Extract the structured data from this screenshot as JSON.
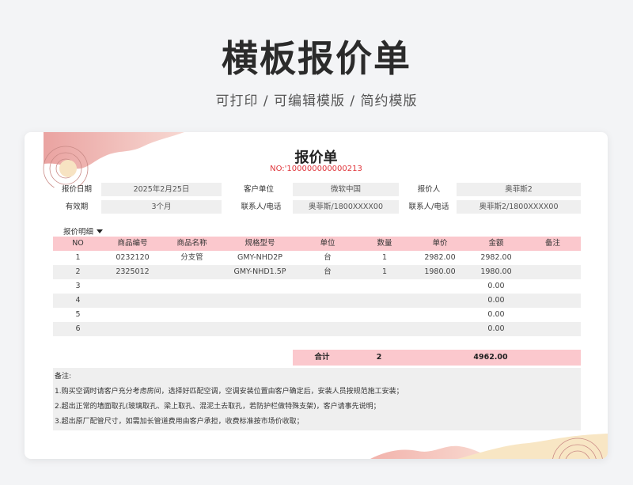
{
  "hero": {
    "title": "横板报价单",
    "subtitle": "可打印 / 可编辑模版 / 简约模版"
  },
  "doc": {
    "title": "报价单",
    "number": "NO:'100000000000213"
  },
  "info": {
    "row1": [
      {
        "label": "报价日期",
        "value": "2025年2月25日"
      },
      {
        "label": "客户单位",
        "value": "微软中国"
      },
      {
        "label": "报价人",
        "value": "奥菲斯2"
      }
    ],
    "row2": [
      {
        "label": "有效期",
        "value": "3个月"
      },
      {
        "label": "联系人/电话",
        "value": "奥菲斯/1800XXXX00"
      },
      {
        "label": "联系人/电话",
        "value": "奥菲斯2/1800XXXX00"
      }
    ]
  },
  "detail_label": "报价明细",
  "table": {
    "headers": [
      "NO",
      "商品编号",
      "商品名称",
      "规格型号",
      "单位",
      "数量",
      "单价",
      "金额",
      "备注"
    ],
    "rows": [
      [
        "1",
        "0232120",
        "分支管",
        "GMY-NHD2P",
        "台",
        "1",
        "2982.00",
        "2982.00",
        ""
      ],
      [
        "2",
        "2325012",
        "",
        "GMY-NHD1.5P",
        "台",
        "1",
        "1980.00",
        "1980.00",
        ""
      ],
      [
        "3",
        "",
        "",
        "",
        "",
        "",
        "",
        "0.00",
        ""
      ],
      [
        "4",
        "",
        "",
        "",
        "",
        "",
        "",
        "0.00",
        ""
      ],
      [
        "5",
        "",
        "",
        "",
        "",
        "",
        "",
        "0.00",
        ""
      ],
      [
        "6",
        "",
        "",
        "",
        "",
        "",
        "",
        "0.00",
        ""
      ]
    ]
  },
  "total": {
    "label": "合计",
    "qty": "2",
    "amount": "4962.00"
  },
  "notes": {
    "title": "备注:",
    "lines": [
      "1.购买空调时请客户充分考虑房间，选择好匹配空调，空调安装位置由客户确定后，安装人员按规范施工安装；",
      "2.超出正常的墙面取孔(玻璃取孔、梁上取孔、混泥土去取孔，若防护栏做特殊支架)，客户请事先说明；",
      "3.超出原厂配管尺寸，如需加长管道费用由客户承担，收费标准按市场价收取；"
    ]
  },
  "colors": {
    "accent_pink": "#fbc8cd",
    "number_red": "#e0343a",
    "cell_gray": "#efefef"
  }
}
